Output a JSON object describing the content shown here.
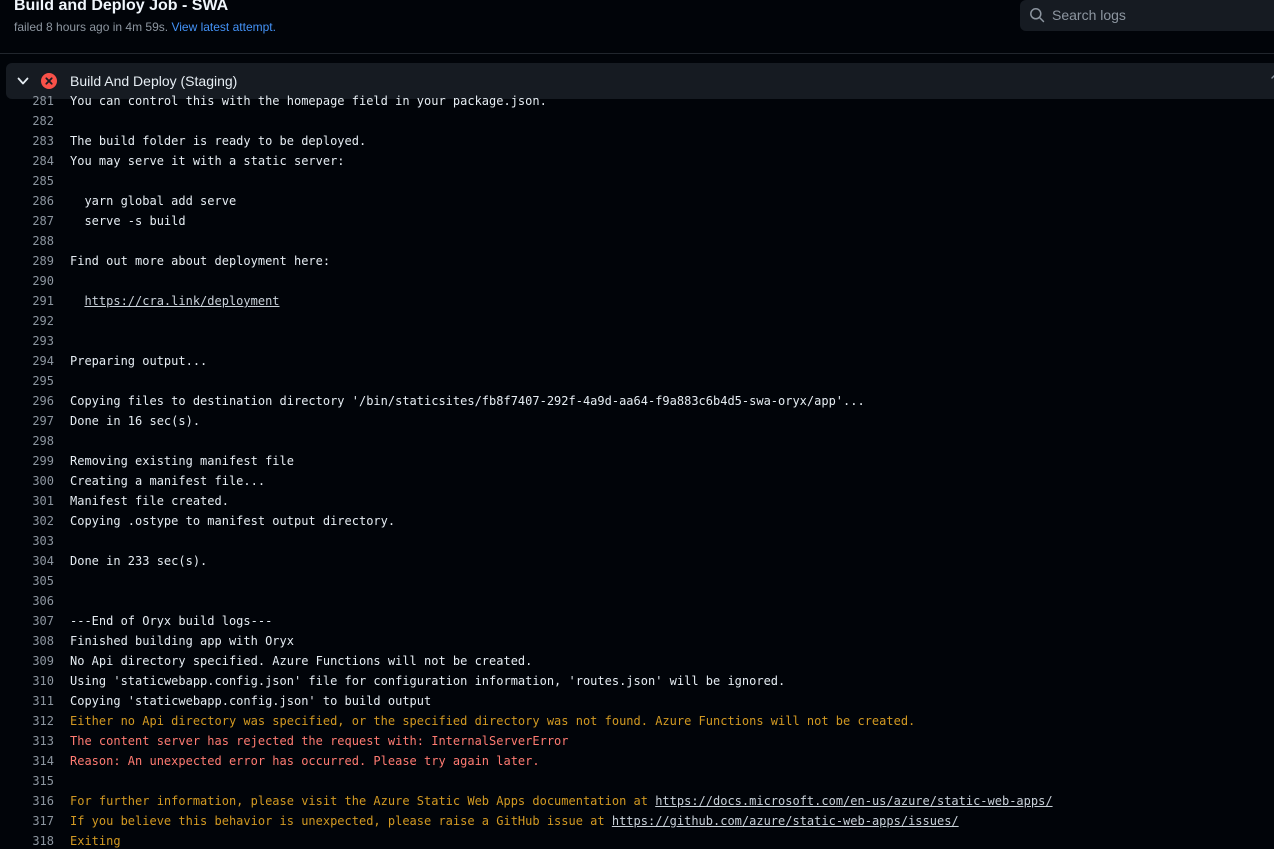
{
  "header": {
    "title": "Build and Deploy Job - SWA",
    "status_text": "failed 8 hours ago in 4m 59s.",
    "latest_attempt_link": "View latest attempt."
  },
  "search": {
    "placeholder": "Search logs",
    "icon": "search-icon"
  },
  "step": {
    "title": "Build And Deploy (Staging)",
    "status": "failed",
    "status_icon": "x-circle-fill-icon",
    "colors": {
      "failure": "#f85149",
      "warning": "#d29922",
      "error_text": "#ff7b72"
    }
  },
  "log": {
    "lines": [
      {
        "n": "281",
        "text": "You can control this with the homepage field in your package.json.",
        "kind": "normal"
      },
      {
        "n": "282",
        "text": "",
        "kind": "normal"
      },
      {
        "n": "283",
        "text": "The build folder is ready to be deployed.",
        "kind": "normal"
      },
      {
        "n": "284",
        "text": "You may serve it with a static server:",
        "kind": "normal"
      },
      {
        "n": "285",
        "text": "",
        "kind": "normal"
      },
      {
        "n": "286",
        "text": "  yarn global add serve",
        "kind": "normal"
      },
      {
        "n": "287",
        "text": "  serve -s build",
        "kind": "normal"
      },
      {
        "n": "288",
        "text": "",
        "kind": "normal"
      },
      {
        "n": "289",
        "text": "Find out more about deployment here:",
        "kind": "normal"
      },
      {
        "n": "290",
        "text": "",
        "kind": "normal"
      },
      {
        "n": "291",
        "text": "  ",
        "link": "https://cra.link/deployment",
        "after": "",
        "kind": "normal"
      },
      {
        "n": "292",
        "text": "",
        "kind": "normal"
      },
      {
        "n": "293",
        "text": "",
        "kind": "normal"
      },
      {
        "n": "294",
        "text": "Preparing output...",
        "kind": "normal"
      },
      {
        "n": "295",
        "text": "",
        "kind": "normal"
      },
      {
        "n": "296",
        "text": "Copying files to destination directory '/bin/staticsites/fb8f7407-292f-4a9d-aa64-f9a883c6b4d5-swa-oryx/app'...",
        "kind": "normal"
      },
      {
        "n": "297",
        "text": "Done in 16 sec(s).",
        "kind": "normal"
      },
      {
        "n": "298",
        "text": "",
        "kind": "normal"
      },
      {
        "n": "299",
        "text": "Removing existing manifest file",
        "kind": "normal"
      },
      {
        "n": "300",
        "text": "Creating a manifest file...",
        "kind": "normal"
      },
      {
        "n": "301",
        "text": "Manifest file created.",
        "kind": "normal"
      },
      {
        "n": "302",
        "text": "Copying .ostype to manifest output directory.",
        "kind": "normal"
      },
      {
        "n": "303",
        "text": "",
        "kind": "normal"
      },
      {
        "n": "304",
        "text": "Done in 233 sec(s).",
        "kind": "normal"
      },
      {
        "n": "305",
        "text": "",
        "kind": "normal"
      },
      {
        "n": "306",
        "text": "",
        "kind": "normal"
      },
      {
        "n": "307",
        "text": "---End of Oryx build logs---",
        "kind": "normal"
      },
      {
        "n": "308",
        "text": "Finished building app with Oryx",
        "kind": "normal"
      },
      {
        "n": "309",
        "text": "No Api directory specified. Azure Functions will not be created.",
        "kind": "normal"
      },
      {
        "n": "310",
        "text": "Using 'staticwebapp.config.json' file for configuration information, 'routes.json' will be ignored.",
        "kind": "normal"
      },
      {
        "n": "311",
        "text": "Copying 'staticwebapp.config.json' to build output",
        "kind": "normal"
      },
      {
        "n": "312",
        "text": "Either no Api directory was specified, or the specified directory was not found. Azure Functions will not be created.",
        "kind": "warn"
      },
      {
        "n": "313",
        "text": "The content server has rejected the request with: InternalServerError",
        "kind": "err"
      },
      {
        "n": "314",
        "text": "Reason: An unexpected error has occurred. Please try again later.",
        "kind": "err"
      },
      {
        "n": "315",
        "text": "",
        "kind": "normal"
      },
      {
        "n": "316",
        "text": "For further information, please visit the Azure Static Web Apps documentation at ",
        "link": "https://docs.microsoft.com/en-us/azure/static-web-apps/",
        "after": "",
        "kind": "warn"
      },
      {
        "n": "317",
        "text": "If you believe this behavior is unexpected, please raise a GitHub issue at ",
        "link": "https://github.com/azure/static-web-apps/issues/",
        "after": "",
        "kind": "warn"
      },
      {
        "n": "318",
        "text": "Exiting",
        "kind": "warn"
      }
    ]
  }
}
